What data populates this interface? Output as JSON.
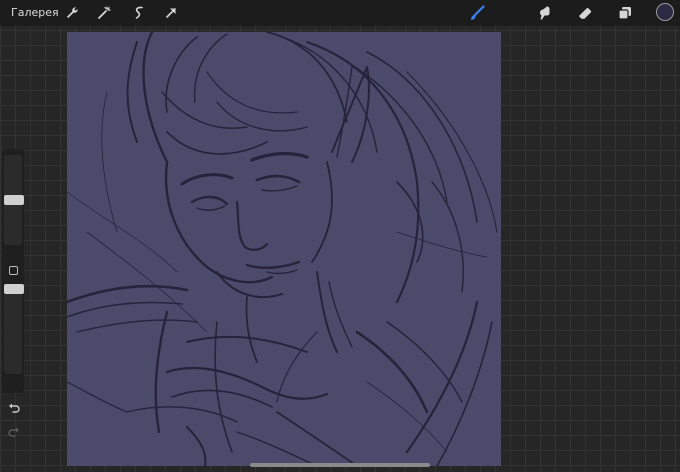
{
  "topbar": {
    "gallery_label": "Галерея",
    "left_tools": [
      "wrench-icon",
      "magic-wand-icon",
      "selection-icon",
      "transform-arrow-icon"
    ],
    "right_tools": [
      "brush-icon",
      "smudge-icon",
      "eraser-icon",
      "layers-icon"
    ],
    "active_tool": "brush-icon",
    "current_color": "#2c2a45"
  },
  "canvas": {
    "background_color": "#4b4a6b",
    "stroke_color": "#26233a"
  },
  "sidebar": {
    "brush_size_fraction": 0.5,
    "opacity_fraction": 0.0,
    "modify_button": "square-icon",
    "undo": "undo-icon",
    "redo": "redo-icon"
  }
}
